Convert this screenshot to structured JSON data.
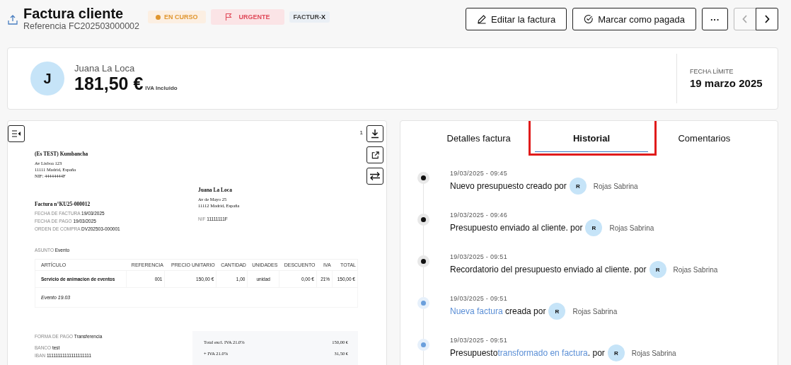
{
  "header": {
    "title": "Factura cliente",
    "reference": "Referencia FC202503000002",
    "badges": [
      {
        "kind": "status",
        "label": "EN CURSO"
      },
      {
        "kind": "flag",
        "label": "URGENTE"
      },
      {
        "kind": "format",
        "label": "FACTUR-",
        "strong": "X"
      }
    ],
    "buttons": [
      {
        "kind": "edit",
        "label": "Editar la factura"
      },
      {
        "kind": "check",
        "label": "Marcar como pagada"
      },
      {
        "kind": "more",
        "label": "···"
      }
    ],
    "pager": [
      {
        "kind": "prev",
        "disabled": true
      },
      {
        "kind": "next",
        "disabled": false
      }
    ]
  },
  "summary": {
    "avatar": "J",
    "client": "Juana La Loca",
    "amount": "181,50 €",
    "amount_note": "IVA Incluido",
    "due_label": "FECHA LÍMITE",
    "due_date": "19 marzo 2025"
  },
  "document": {
    "page": "1",
    "seller": {
      "name": "(Es TEST) Kumbancha",
      "lines": [
        "Av Lisboa 123",
        "11111 Madrid, España",
        "NIF: 44444444F"
      ]
    },
    "buyer": {
      "name": "Juana La Loca",
      "lines": [
        "Av de Mayo 25",
        "11112 Madrid, España"
      ],
      "nif_label": "NIF",
      "nif": "11111111F"
    },
    "number": "Factura n°KU25-000012",
    "fields": [
      {
        "label": "FECHA DE FACTURA",
        "value": "19/03/2025"
      },
      {
        "label": "FECHA DE PAGO",
        "value": "19/03/2025"
      },
      {
        "label": "ORDEN DE COMPRA",
        "value": "DV202503-000001"
      }
    ],
    "subject_label": "ASUNTO",
    "subject": "Evento",
    "table": {
      "columns": [
        "ARTÍCULO",
        "REFERENCIA",
        "PRECIO UNITARIO",
        "CANTIDAD",
        "UNIDADES",
        "DESCUENTO",
        "IVA",
        "TOTAL"
      ],
      "rows": [
        [
          "Servicio de animacion de eventos",
          "001",
          "150,00 €",
          "1,00",
          "unidad",
          "0,00 €",
          "21%",
          "150,00 €"
        ]
      ],
      "note": "Evento 19.03"
    },
    "payment": [
      {
        "label": "FORMA DE PAGO",
        "value": "Transferencia"
      },
      {
        "label": "BANCO",
        "value": "test"
      },
      {
        "label": "IBAN",
        "value": "11111111111111111111"
      }
    ],
    "totals": [
      {
        "label": "Total excl. IVA 21.0%",
        "value": "150,00 €"
      },
      {
        "label": "+ IVA 21.0%",
        "value": "31,50 €"
      }
    ]
  },
  "tabs": [
    {
      "label": "Detalles factura",
      "selected": false,
      "highlighted": false
    },
    {
      "label": "Historial",
      "selected": true,
      "highlighted": true
    },
    {
      "label": "Comentarios",
      "selected": false,
      "highlighted": false
    }
  ],
  "history": [
    {
      "date": "19/03/2025 - 09:45",
      "color": "#111111",
      "parts": [
        {
          "text": "Nuevo presupuesto creado por",
          "link": false
        }
      ],
      "author_initial": "R",
      "author": "Rojas Sabrina"
    },
    {
      "date": "19/03/2025 - 09:46",
      "color": "#111111",
      "parts": [
        {
          "text": "Presupuesto enviado al cliente. por",
          "link": false
        }
      ],
      "author_initial": "R",
      "author": "Rojas Sabrina"
    },
    {
      "date": "19/03/2025 - 09:51",
      "color": "#111111",
      "parts": [
        {
          "text": "Recordatorio del presupuesto enviado al cliente. por",
          "link": false
        }
      ],
      "author_initial": "R",
      "author": "Rojas Sabrina"
    },
    {
      "date": "19/03/2025 - 09:51",
      "color": "#6a9fdc",
      "parts": [
        {
          "text": "Nueva factura",
          "link": true
        },
        {
          "text": " creada por",
          "link": false
        }
      ],
      "author_initial": "R",
      "author": "Rojas Sabrina"
    },
    {
      "date": "19/03/2025 - 09:51",
      "color": "#6a9fdc",
      "parts": [
        {
          "text": "Presupuesto",
          "link": false
        },
        {
          "text": "transformado en factura",
          "link": true
        },
        {
          "text": ". por",
          "link": false
        }
      ],
      "author_initial": "R",
      "author": "Rojas Sabrina"
    }
  ]
}
